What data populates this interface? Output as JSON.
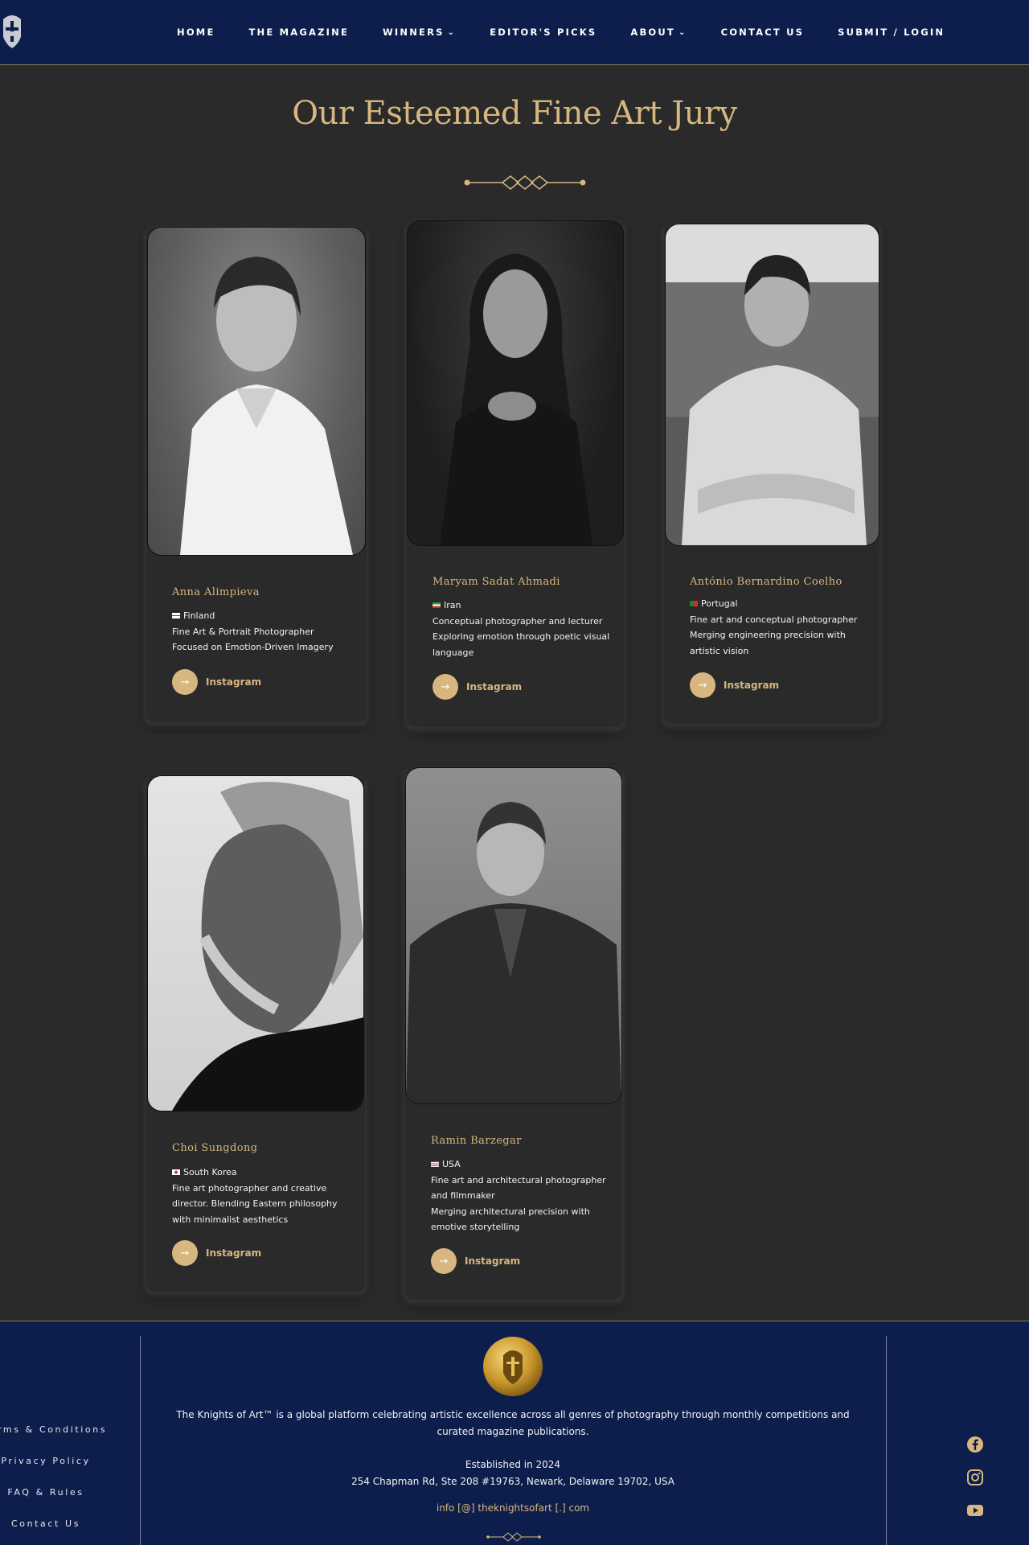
{
  "nav": {
    "items": [
      {
        "label": "HOME",
        "dropdown": false
      },
      {
        "label": "THE MAGAZINE",
        "dropdown": false
      },
      {
        "label": "WINNERS",
        "dropdown": true
      },
      {
        "label": "EDITOR'S PICKS",
        "dropdown": false
      },
      {
        "label": "ABOUT",
        "dropdown": true
      },
      {
        "label": "CONTACT US",
        "dropdown": false
      },
      {
        "label": "SUBMIT / LOGIN",
        "dropdown": false
      }
    ]
  },
  "page": {
    "title": "Our Esteemed Fine Art Jury"
  },
  "colors": {
    "navy": "#0d1e4d",
    "gold": "#d7b77f",
    "background": "#2a2a2a"
  },
  "jury": [
    {
      "name": "Anna Alimpieva",
      "country": "Finland",
      "lines": [
        "Fine Art & Portrait Photographer",
        "Focused on Emotion-Driven Imagery"
      ],
      "link": "Instagram"
    },
    {
      "name": "Maryam Sadat Ahmadi",
      "country": "Iran",
      "lines": [
        "Conceptual photographer and lecturer",
        "Exploring emotion through poetic visual",
        "language"
      ],
      "link": "Instagram"
    },
    {
      "name": "António Bernardino Coelho",
      "country": "Portugal",
      "lines": [
        "Fine art and conceptual photographer",
        "Merging engineering precision with",
        "artistic vision"
      ],
      "link": "Instagram"
    },
    {
      "name": "Choi Sungdong",
      "country": "South Korea",
      "lines": [
        "Fine art photographer and creative",
        "director. Blending Eastern philosophy",
        "with minimalist aesthetics"
      ],
      "link": "Instagram"
    },
    {
      "name": "Ramin Barzegar",
      "country": "USA",
      "lines": [
        "Fine art and architectural photographer",
        "and filmmaker",
        "Merging architectural precision with",
        "emotive storytelling"
      ],
      "link": "Instagram"
    }
  ],
  "footer": {
    "links": [
      "rms & Conditions",
      "Privacy Policy",
      "FAQ & Rules",
      "Contact Us"
    ],
    "description": "The Knights of Art™ is a global platform celebrating artistic excellence across all genres of photography through monthly competitions and curated magazine publications.",
    "established": "Established in 2024",
    "address": "254 Chapman Rd, Ste 208 #19763, Newark, Delaware 19702, USA",
    "email": "info [@] theknightsofart [.] com",
    "social": [
      "facebook-icon",
      "instagram-icon",
      "youtube-icon"
    ]
  }
}
